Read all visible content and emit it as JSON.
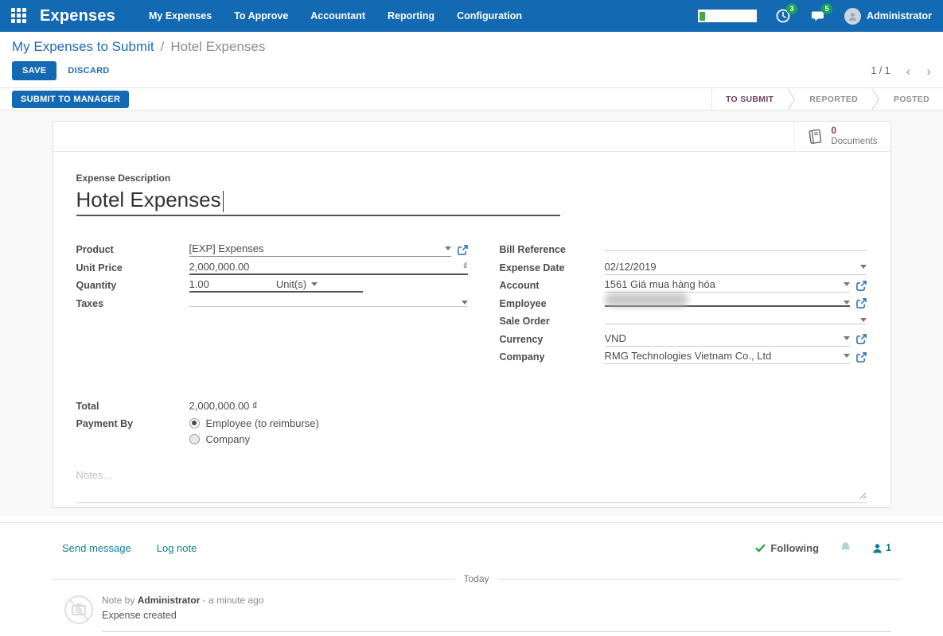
{
  "colors": {
    "topbar_blue": "#1469b3",
    "primary_button": "#1469b3",
    "status_active": "#6b3e63",
    "doc_count_purple": "#8a3e6a",
    "chatter_teal": "#0c8291",
    "badge_green": "#17a358",
    "following_check_green": "#28a745"
  },
  "topbar": {
    "brand": "Expenses",
    "menus": [
      "My Expenses",
      "To Approve",
      "Accountant",
      "Reporting",
      "Configuration"
    ],
    "clock_badge": "3",
    "messages_badge": "5",
    "user": "Administrator"
  },
  "breadcrumb": {
    "parent": "My Expenses to Submit",
    "separator": "/",
    "current": "Hotel Expenses"
  },
  "actions": {
    "save": "SAVE",
    "discard": "DISCARD",
    "pager": "1 / 1",
    "prev": "‹",
    "next": "›"
  },
  "statusbar": {
    "submit_button": "SUBMIT TO MANAGER",
    "steps": [
      {
        "label": "TO SUBMIT"
      },
      {
        "label": "REPORTED"
      },
      {
        "label": "POSTED"
      }
    ]
  },
  "button_box": {
    "count": "0",
    "label": "Documents"
  },
  "form": {
    "description_label": "Expense Description",
    "description_value": "Hotel Expenses",
    "product": {
      "label": "Product",
      "value": "[EXP] Expenses"
    },
    "unit_price": {
      "label": "Unit Price",
      "value": "2,000,000.00",
      "currency": "₫"
    },
    "quantity": {
      "label": "Quantity",
      "value": "1.00",
      "uom": "Unit(s)"
    },
    "taxes": {
      "label": "Taxes",
      "value": ""
    },
    "bill_reference": {
      "label": "Bill Reference",
      "value": ""
    },
    "expense_date": {
      "label": "Expense Date",
      "value": "02/12/2019"
    },
    "account": {
      "label": "Account",
      "value": "1561 Giá mua hàng hóa"
    },
    "employee": {
      "label": "Employee",
      "value": ""
    },
    "sale_order": {
      "label": "Sale Order",
      "value": ""
    },
    "currency": {
      "label": "Currency",
      "value": "VND"
    },
    "company": {
      "label": "Company",
      "value": "RMG Technologies Vietnam Co., Ltd"
    },
    "total": {
      "label": "Total",
      "value": "2,000,000.00 ₫"
    },
    "payment_by": {
      "label": "Payment By",
      "options": [
        "Employee (to reimburse)",
        "Company"
      ],
      "selected": "Employee (to reimburse)"
    },
    "notes_placeholder": "Notes..."
  },
  "chatter": {
    "send_message": "Send message",
    "log_note": "Log note",
    "following": "Following",
    "followers_count": "1",
    "day_separator": "Today",
    "message": {
      "prefix": "Note by",
      "author": "Administrator",
      "time": "- a minute ago",
      "body": "Expense created"
    }
  }
}
